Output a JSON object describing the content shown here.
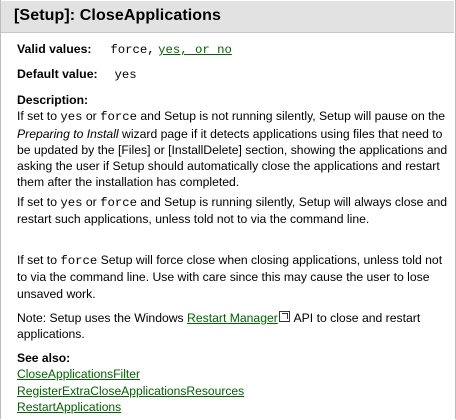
{
  "title": "[Setup]: CloseApplications",
  "valid": {
    "label": "Valid values:",
    "plain": "force,",
    "link": "yes, or no"
  },
  "default": {
    "label": "Default value:",
    "value": "yes"
  },
  "description": {
    "heading": "Description:",
    "p1": {
      "t1": "If set to ",
      "c1": "yes",
      "t2": " or ",
      "c2": "force",
      "t3": " and Setup is not running silently, Setup will pause on the ",
      "i1": "Preparing to Install",
      "t4": " wizard page if it detects applications using files that need to be updated by the [Files] or [InstallDelete] section, showing the applications and asking the user if Setup should automatically close the applications and restart them after the installation has completed."
    },
    "p2": {
      "t1": "If set to ",
      "c1": "yes",
      "t2": " or ",
      "c2": "force",
      "t3": " and Setup is running silently, Setup will always close and restart such applications, unless told not to via the command line."
    },
    "p3": {
      "t1": "If set to ",
      "c1": "force",
      "t2": " Setup will force close when closing applications, unless told not to via the command line. Use with care since this may cause the user to lose unsaved work."
    },
    "p4": {
      "t1": "Note: Setup uses the Windows ",
      "link": "Restart Manager",
      "t2": " API to close and restart applications."
    }
  },
  "see_also": {
    "heading": "See also:",
    "links": [
      "CloseApplicationsFilter",
      "RegisterExtraCloseApplicationsResources",
      "RestartApplications"
    ]
  }
}
